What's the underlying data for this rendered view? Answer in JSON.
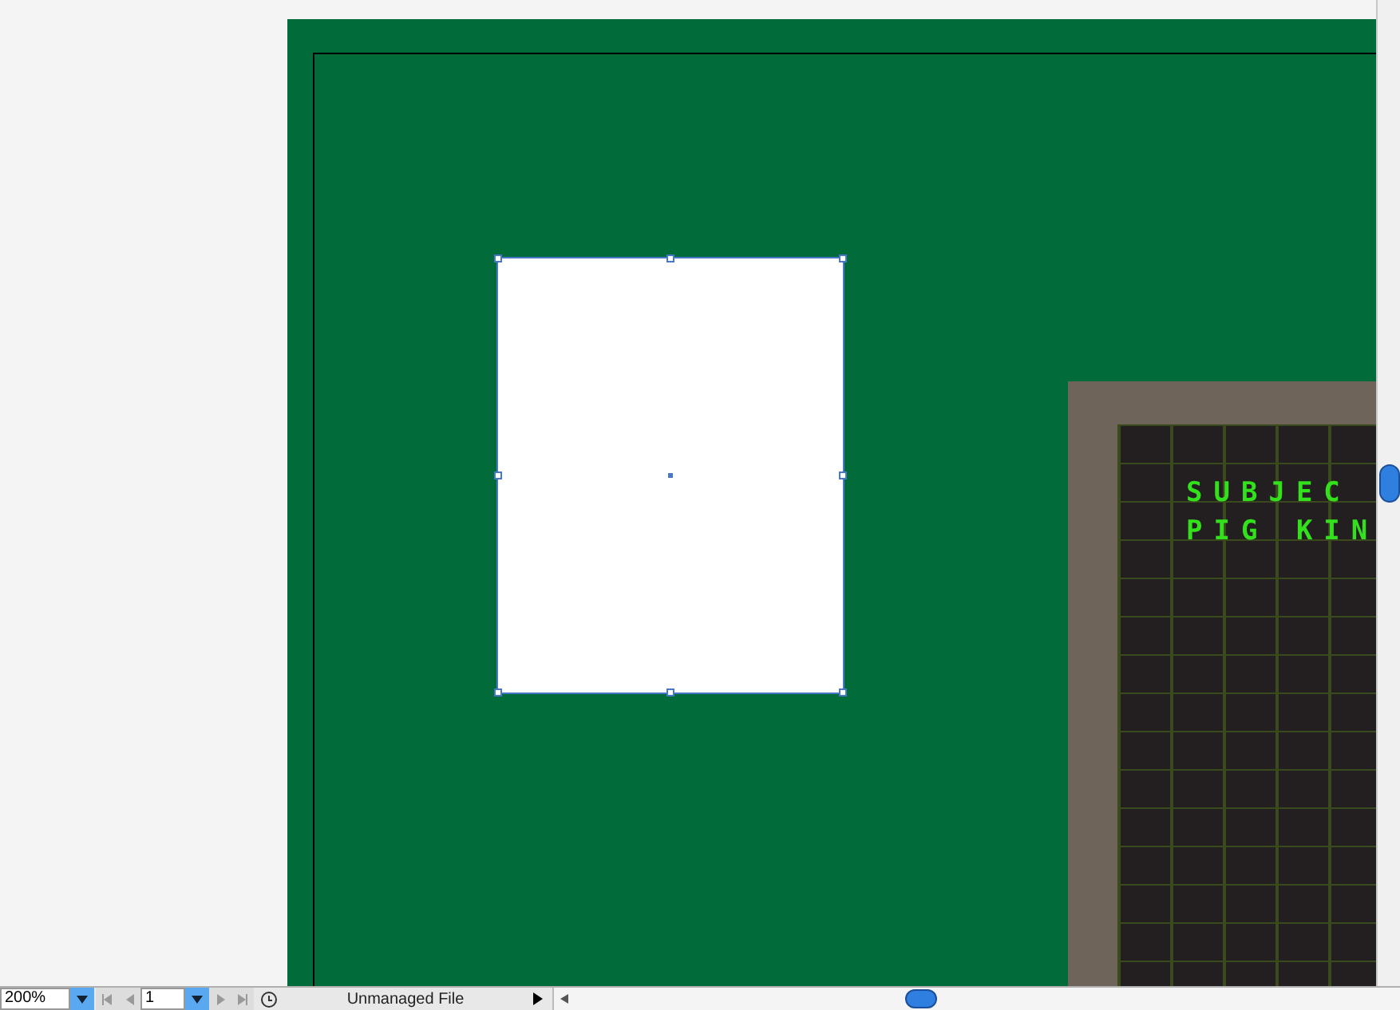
{
  "canvas": {
    "selected_shape": {
      "selected": true
    },
    "screen_text": [
      "SUBJEC",
      "PIG KIN"
    ]
  },
  "status_bar": {
    "zoom": "200%",
    "page": "1",
    "file_status": "Unmanaged File"
  }
}
